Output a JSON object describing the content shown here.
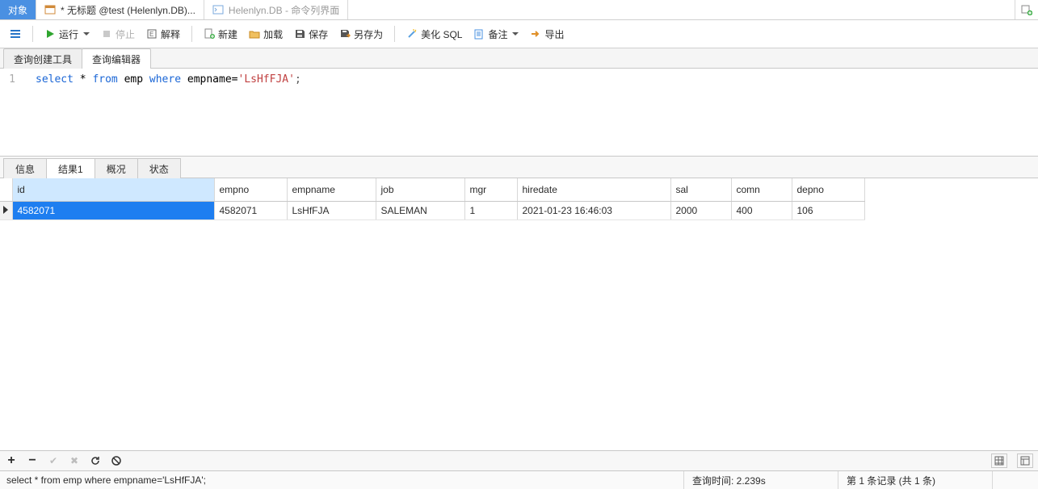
{
  "tabs": {
    "objects": "对象",
    "untitled": "* 无标题 @test (Helenlyn.DB)...",
    "cmdline": "Helenlyn.DB",
    "cmdline_suffix": " - 命令列界面"
  },
  "toolbar": {
    "run": "运行",
    "stop": "停止",
    "explain": "解释",
    "new": "新建",
    "load": "加载",
    "save": "保存",
    "saveas": "另存为",
    "beautify": "美化 SQL",
    "notes": "备注",
    "export": "导出"
  },
  "innerTabs": {
    "builder": "查询创建工具",
    "editor": "查询编辑器"
  },
  "sql": {
    "line": "1",
    "kw_select": "select",
    "star": " * ",
    "kw_from": "from",
    "sp": "  ",
    "tbl": "emp ",
    "kw_where": "where",
    "col": " empname=",
    "lit": "'LsHfFJA'",
    "semi": ";"
  },
  "resTabs": {
    "info": "信息",
    "result": "结果1",
    "profile": "概况",
    "status": "状态"
  },
  "columns": [
    "id",
    "empno",
    "empname",
    "job",
    "mgr",
    "hiredate",
    "sal",
    "comn",
    "depno"
  ],
  "row": {
    "id": "4582071",
    "empno": "4582071",
    "empname": "LsHfFJA",
    "job": "SALEMAN",
    "mgr": "1",
    "hiredate": "2021-01-23 16:46:03",
    "sal": "2000",
    "comn": "400",
    "depno": "106"
  },
  "statusbar": {
    "sql": "select * from  emp where empname='LsHfFJA';",
    "time": "查询时间: 2.239s",
    "records": "第 1 条记录 (共 1 条)"
  }
}
